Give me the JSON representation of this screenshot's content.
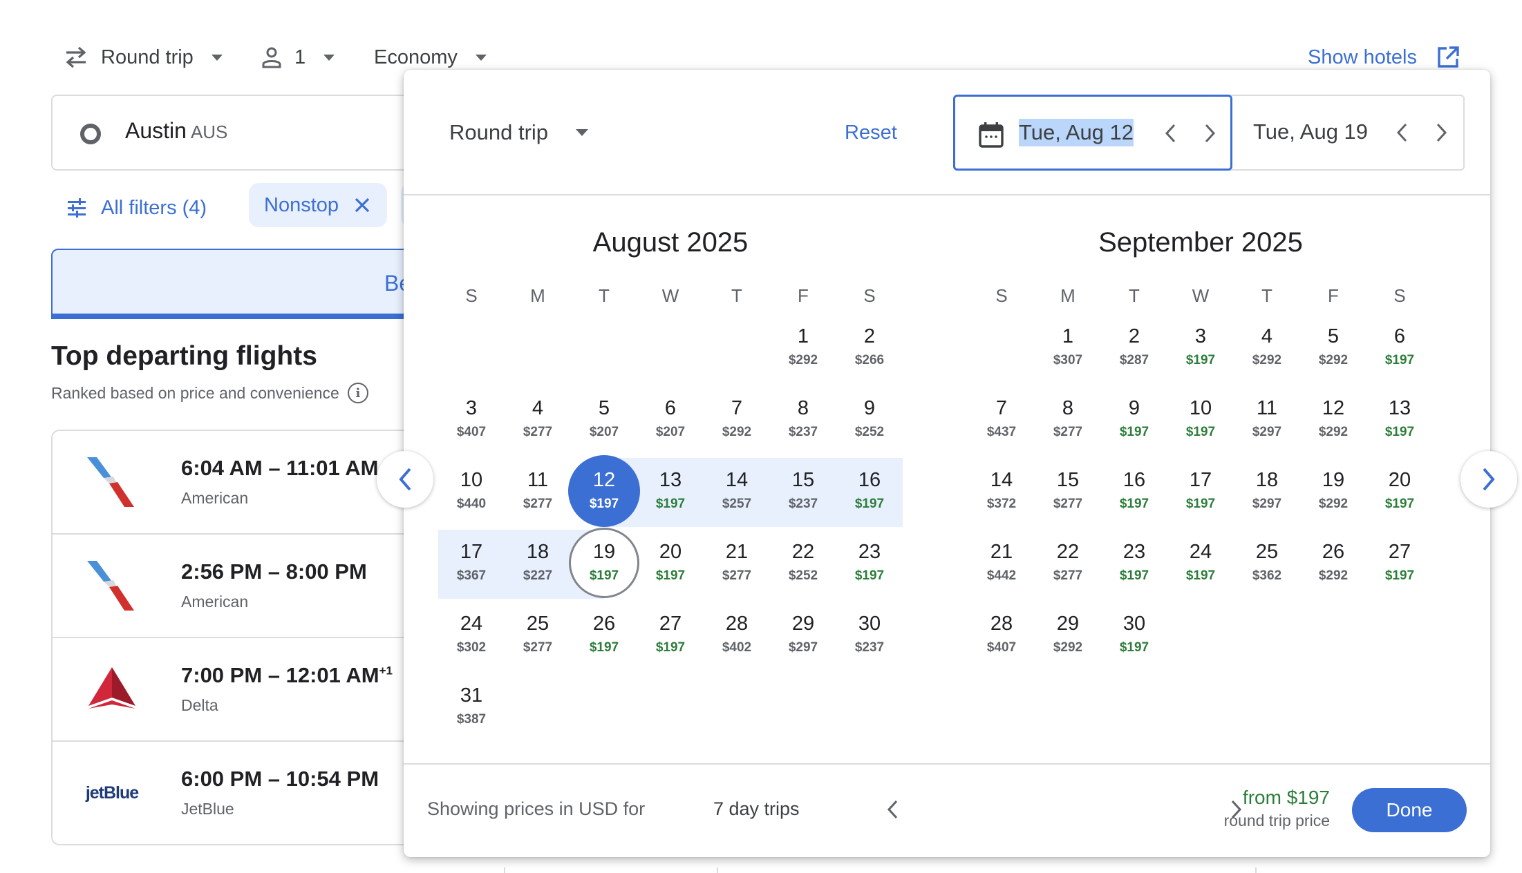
{
  "toolbar": {
    "trip_type": "Round trip",
    "passengers": "1",
    "cabin_class": "Economy",
    "show_hotels": "Show hotels"
  },
  "search": {
    "origin_city": "Austin",
    "origin_code": "AUS"
  },
  "filters": {
    "all_filters": "All filters (4)",
    "chips": [
      {
        "label": "Nonstop"
      }
    ]
  },
  "tabs": {
    "best": "Best"
  },
  "flights": {
    "title": "Top departing flights",
    "subtitle": "Ranked based on price and convenience",
    "items": [
      {
        "times": "6:04 AM – 11:01 AM",
        "day_offset": "",
        "airline": "American",
        "logo": "american-airlines-logo"
      },
      {
        "times": "2:56 PM – 8:00 PM",
        "day_offset": "",
        "airline": "American",
        "logo": "american-airlines-logo"
      },
      {
        "times": "7:00 PM – 12:01 AM",
        "day_offset": "+1",
        "airline": "Delta",
        "logo": "delta-logo"
      },
      {
        "times": "6:00 PM – 10:54 PM",
        "day_offset": "",
        "airline": "JetBlue",
        "logo": "jetblue-logo",
        "logo_text": "jetBlue"
      }
    ]
  },
  "date_picker": {
    "trip_type": "Round trip",
    "reset": "Reset",
    "start_date": "Tue, Aug 12",
    "end_date": "Tue, Aug 19",
    "weekdays": [
      "S",
      "M",
      "T",
      "W",
      "T",
      "F",
      "S"
    ],
    "months": [
      {
        "title": "August 2025",
        "first_weekday": 5,
        "days": [
          {
            "d": "1",
            "p": "$292"
          },
          {
            "d": "2",
            "p": "$266"
          },
          {
            "d": "3",
            "p": "$407"
          },
          {
            "d": "4",
            "p": "$277"
          },
          {
            "d": "5",
            "p": "$207"
          },
          {
            "d": "6",
            "p": "$207"
          },
          {
            "d": "7",
            "p": "$292"
          },
          {
            "d": "8",
            "p": "$237"
          },
          {
            "d": "9",
            "p": "$252"
          },
          {
            "d": "10",
            "p": "$440"
          },
          {
            "d": "11",
            "p": "$277"
          },
          {
            "d": "12",
            "p": "$197",
            "low": true,
            "state": "start"
          },
          {
            "d": "13",
            "p": "$197",
            "low": true
          },
          {
            "d": "14",
            "p": "$257"
          },
          {
            "d": "15",
            "p": "$237"
          },
          {
            "d": "16",
            "p": "$197",
            "low": true
          },
          {
            "d": "17",
            "p": "$367"
          },
          {
            "d": "18",
            "p": "$227"
          },
          {
            "d": "19",
            "p": "$197",
            "low": true,
            "state": "end"
          },
          {
            "d": "20",
            "p": "$197",
            "low": true
          },
          {
            "d": "21",
            "p": "$277"
          },
          {
            "d": "22",
            "p": "$252"
          },
          {
            "d": "23",
            "p": "$197",
            "low": true
          },
          {
            "d": "24",
            "p": "$302"
          },
          {
            "d": "25",
            "p": "$277"
          },
          {
            "d": "26",
            "p": "$197",
            "low": true
          },
          {
            "d": "27",
            "p": "$197",
            "low": true
          },
          {
            "d": "28",
            "p": "$402"
          },
          {
            "d": "29",
            "p": "$297"
          },
          {
            "d": "30",
            "p": "$237"
          },
          {
            "d": "31",
            "p": "$387"
          }
        ]
      },
      {
        "title": "September 2025",
        "first_weekday": 1,
        "days": [
          {
            "d": "1",
            "p": "$307"
          },
          {
            "d": "2",
            "p": "$287"
          },
          {
            "d": "3",
            "p": "$197",
            "low": true
          },
          {
            "d": "4",
            "p": "$292"
          },
          {
            "d": "5",
            "p": "$292"
          },
          {
            "d": "6",
            "p": "$197",
            "low": true
          },
          {
            "d": "7",
            "p": "$437"
          },
          {
            "d": "8",
            "p": "$277"
          },
          {
            "d": "9",
            "p": "$197",
            "low": true
          },
          {
            "d": "10",
            "p": "$197",
            "low": true
          },
          {
            "d": "11",
            "p": "$297"
          },
          {
            "d": "12",
            "p": "$292"
          },
          {
            "d": "13",
            "p": "$197",
            "low": true
          },
          {
            "d": "14",
            "p": "$372"
          },
          {
            "d": "15",
            "p": "$277"
          },
          {
            "d": "16",
            "p": "$197",
            "low": true
          },
          {
            "d": "17",
            "p": "$197",
            "low": true
          },
          {
            "d": "18",
            "p": "$297"
          },
          {
            "d": "19",
            "p": "$292"
          },
          {
            "d": "20",
            "p": "$197",
            "low": true
          },
          {
            "d": "21",
            "p": "$442"
          },
          {
            "d": "22",
            "p": "$277"
          },
          {
            "d": "23",
            "p": "$197",
            "low": true
          },
          {
            "d": "24",
            "p": "$197",
            "low": true
          },
          {
            "d": "25",
            "p": "$362"
          },
          {
            "d": "26",
            "p": "$292"
          },
          {
            "d": "27",
            "p": "$197",
            "low": true
          },
          {
            "d": "28",
            "p": "$407"
          },
          {
            "d": "29",
            "p": "$292"
          },
          {
            "d": "30",
            "p": "$197",
            "low": true
          }
        ]
      }
    ],
    "footer": {
      "showing_prices": "Showing prices in USD for",
      "trip_length": "7 day trips",
      "from_price": "from $197",
      "price_note": "round trip price",
      "done": "Done"
    }
  },
  "colors": {
    "accent": "#3b6fd4",
    "low_price": "#2d7d3a",
    "range_band": "#e8f0fe",
    "text_secondary": "#5f6368"
  }
}
